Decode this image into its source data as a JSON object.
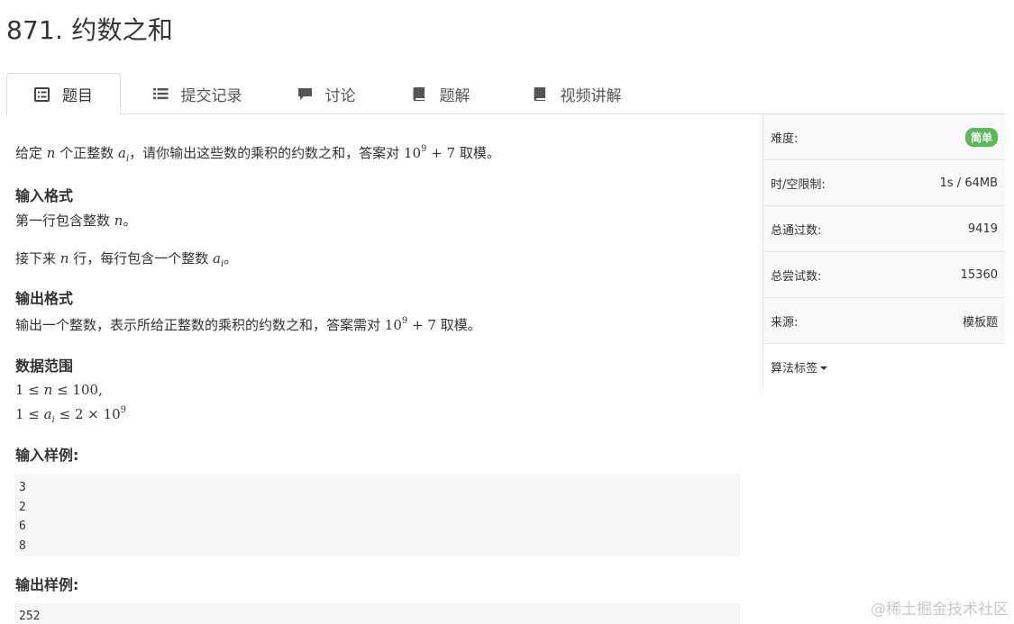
{
  "problem": {
    "title": "871. 约数之和"
  },
  "tabs": [
    {
      "label": "题目",
      "icon": "list-alt-icon",
      "active": true
    },
    {
      "label": "提交记录",
      "icon": "list-icon"
    },
    {
      "label": "讨论",
      "icon": "comment-icon"
    },
    {
      "label": "题解",
      "icon": "book-icon"
    },
    {
      "label": "视频讲解",
      "icon": "book-icon"
    }
  ],
  "statement": {
    "intro_a": "给定 ",
    "intro_n": "n",
    "intro_b": " 个正整数 ",
    "intro_ai": "a",
    "intro_sub": "i",
    "intro_c": "，请你输出这些数的乘积的约数之和，答案对 ",
    "intro_pow_base": "10",
    "intro_pow_exp": "9",
    "intro_d": " + 7",
    "intro_e": " 取模。",
    "input_heading": "输入格式",
    "input_line1_a": "第一行包含整数 ",
    "input_line1_n": "n",
    "input_line1_b": "。",
    "input_line2_a": "接下来 ",
    "input_line2_n": "n",
    "input_line2_b": " 行，每行包含一个整数 ",
    "input_line2_ai": "a",
    "input_line2_sub": "i",
    "input_line2_c": "。",
    "output_heading": "输出格式",
    "output_a": "输出一个整数，表示所给正整数的乘积的约数之和，答案需对 ",
    "output_pow_base": "10",
    "output_pow_exp": "9",
    "output_b": " + 7",
    "output_c": " 取模。",
    "range_heading": "数据范围",
    "range1_a": "1 ≤ ",
    "range1_n": "n",
    "range1_b": " ≤ 100,",
    "range2_a": "1 ≤ ",
    "range2_ai": "a",
    "range2_sub": "i",
    "range2_b": " ≤ 2 × 10",
    "range2_exp": "9",
    "sample_input_heading": "输入样例:",
    "sample_input": [
      "3",
      "2",
      "6",
      "8"
    ],
    "sample_output_heading": "输出样例:",
    "sample_output": [
      "252"
    ]
  },
  "sidebar": {
    "difficulty_label": "难度:",
    "difficulty_value": "简单",
    "difficulty_color": "#5cb85c",
    "limit_label": "时/空限制:",
    "limit_value": "1s / 64MB",
    "passed_label": "总通过数:",
    "passed_value": "9419",
    "attempts_label": "总尝试数:",
    "attempts_value": "15360",
    "source_label": "来源:",
    "source_value": "模板题",
    "tags_label": "算法标签"
  },
  "watermark": "@稀土掘金技术社区"
}
